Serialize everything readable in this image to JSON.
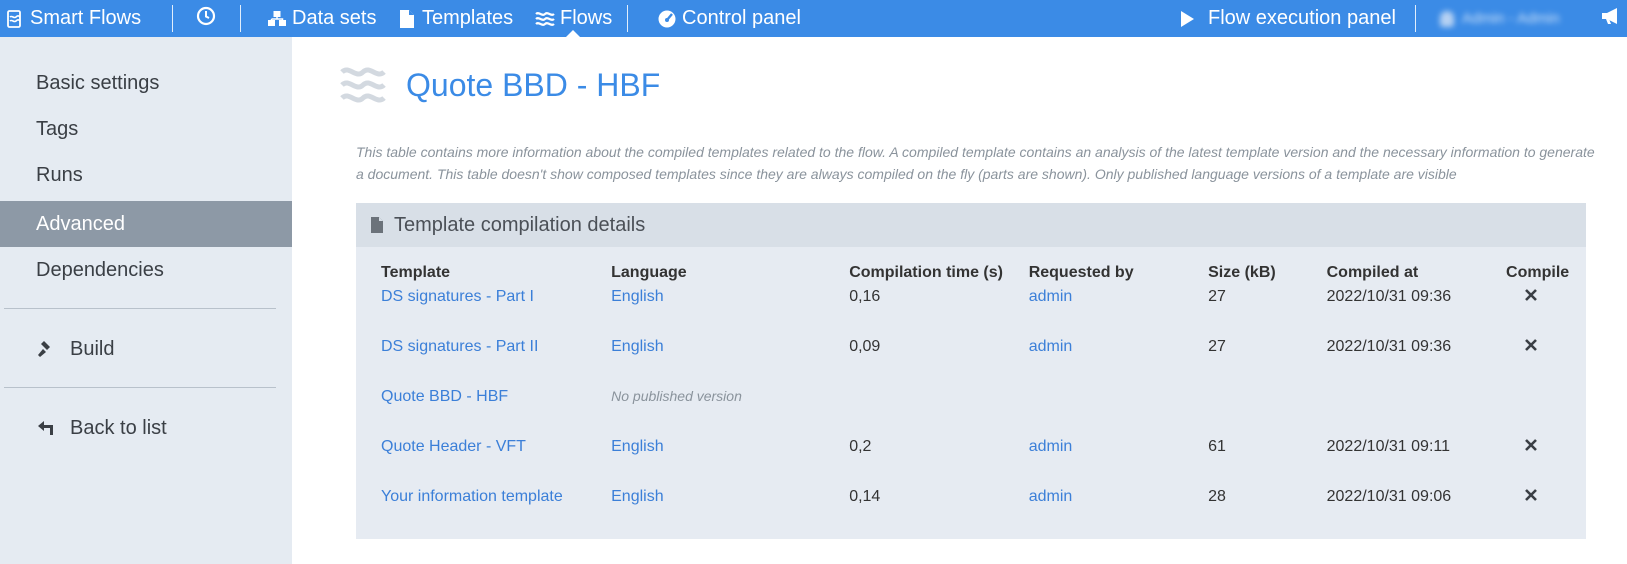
{
  "topbar": {
    "app_name": "Smart Flows",
    "nav": {
      "datasets": "Data sets",
      "templates": "Templates",
      "flows": "Flows",
      "control_panel": "Control panel",
      "flow_execution": "Flow execution panel",
      "user": "Admin - Admin"
    }
  },
  "sidebar": {
    "items": [
      "Basic settings",
      "Tags",
      "Runs",
      "Advanced",
      "Dependencies"
    ],
    "active": "Advanced",
    "build": "Build",
    "back": "Back to list"
  },
  "page": {
    "title": "Quote BBD - HBF",
    "description": "This table contains more information about the compiled templates related to the flow. A compiled template contains an analysis of the latest template version and the necessary information to generate a document. This table doesn't show composed templates since they are always compiled on the fly (parts are shown). Only published language versions of a template are visible"
  },
  "panel": {
    "title": "Template compilation details",
    "columns": [
      "Template",
      "Language",
      "Compilation time (s)",
      "Requested by",
      "Size (kB)",
      "Compiled at",
      "Compile"
    ],
    "rows": [
      {
        "template": "DS signatures - Part I",
        "language": "English",
        "time": "0,16",
        "requested_by": "admin",
        "size": "27",
        "compiled_at": "2022/10/31 09:36"
      },
      {
        "template": "DS signatures - Part II",
        "language": "English",
        "time": "0,09",
        "requested_by": "admin",
        "size": "27",
        "compiled_at": "2022/10/31 09:36"
      },
      {
        "template": "Quote BBD - HBF",
        "language": "No published version",
        "time": "",
        "requested_by": "",
        "size": "",
        "compiled_at": ""
      },
      {
        "template": "Quote Header - VFT",
        "language": "English",
        "time": "0,2",
        "requested_by": "admin",
        "size": "61",
        "compiled_at": "2022/10/31 09:11"
      },
      {
        "template": "Your information template",
        "language": "English",
        "time": "0,14",
        "requested_by": "admin",
        "size": "28",
        "compiled_at": "2022/10/31 09:06"
      }
    ]
  },
  "colors": {
    "topbar": "#3b8be6",
    "sidebar_bg": "#e5ebf2",
    "sidebar_active": "#8d99a6",
    "panel_bg": "#e6ebf2",
    "panel_head": "#d8dfe7",
    "link": "#3b7fd8"
  }
}
